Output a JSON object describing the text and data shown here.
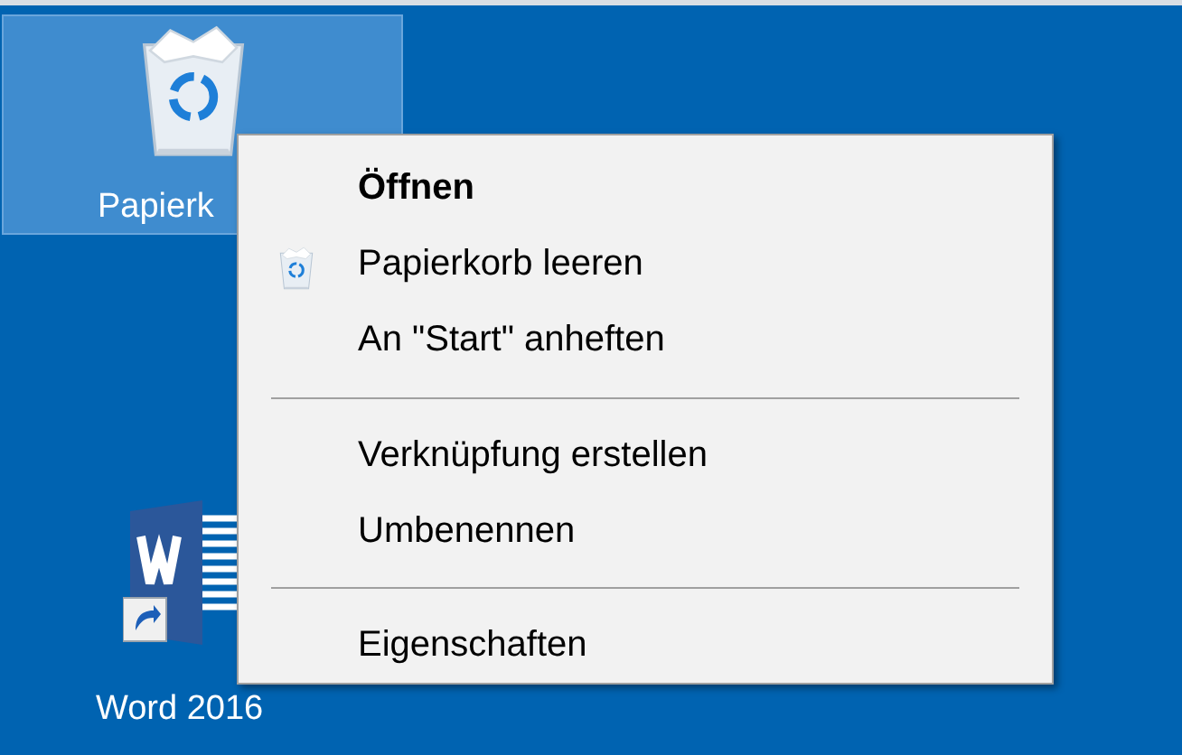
{
  "desktop_icons": [
    {
      "kind": "recycle-bin",
      "label": "Papierk",
      "selected": true
    },
    {
      "kind": "word",
      "label": "Word 2016",
      "selected": false
    }
  ],
  "context_menu": {
    "items": [
      {
        "kind": "item",
        "label": "Öffnen",
        "default": true
      },
      {
        "kind": "bin-item",
        "label": "Papierkorb leeren",
        "default": false
      },
      {
        "kind": "item",
        "label": "An \"Start\" anheften",
        "default": false
      },
      {
        "kind": "separator"
      },
      {
        "kind": "item",
        "label": "Verknüpfung erstellen",
        "default": false
      },
      {
        "kind": "item",
        "label": "Umbenennen",
        "default": false
      },
      {
        "kind": "separator"
      },
      {
        "kind": "item",
        "label": "Eigenschaften",
        "default": false
      }
    ]
  }
}
